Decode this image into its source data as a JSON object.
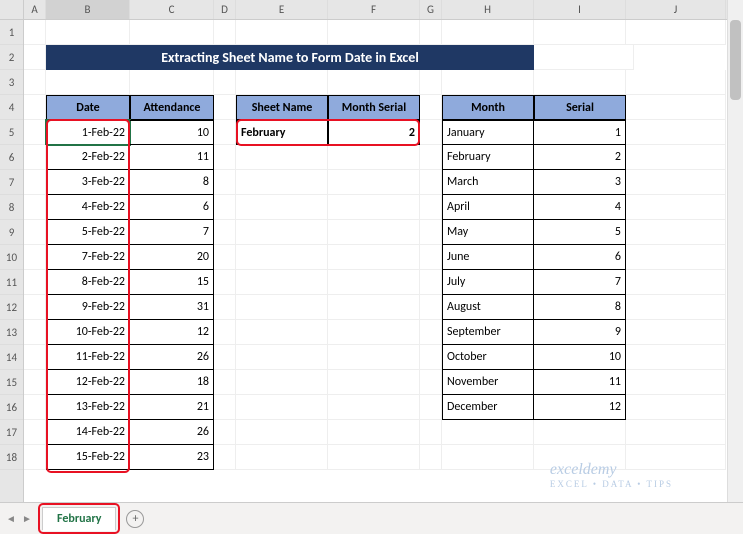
{
  "title": "Extracting Sheet Name to Form Date in Excel",
  "columns": [
    "A",
    "B",
    "C",
    "D",
    "E",
    "F",
    "G",
    "H",
    "I",
    "J"
  ],
  "rowsVisible": 18,
  "headers": {
    "date": "Date",
    "attendance": "Attendance",
    "sheetName": "Sheet Name",
    "monthSerial": "Month Serial",
    "month": "Month",
    "serial": "Serial"
  },
  "lookup": {
    "sheetNameValue": "February",
    "monthSerialValue": 2
  },
  "dateTable": [
    {
      "date": "1-Feb-22",
      "att": 10
    },
    {
      "date": "2-Feb-22",
      "att": 11
    },
    {
      "date": "3-Feb-22",
      "att": 8
    },
    {
      "date": "4-Feb-22",
      "att": 6
    },
    {
      "date": "5-Feb-22",
      "att": 7
    },
    {
      "date": "7-Feb-22",
      "att": 20
    },
    {
      "date": "8-Feb-22",
      "att": 15
    },
    {
      "date": "9-Feb-22",
      "att": 31
    },
    {
      "date": "10-Feb-22",
      "att": 12
    },
    {
      "date": "11-Feb-22",
      "att": 26
    },
    {
      "date": "12-Feb-22",
      "att": 18
    },
    {
      "date": "13-Feb-22",
      "att": 21
    },
    {
      "date": "14-Feb-22",
      "att": 26
    },
    {
      "date": "15-Feb-22",
      "att": 23
    }
  ],
  "monthTable": [
    {
      "m": "January",
      "s": 1
    },
    {
      "m": "February",
      "s": 2
    },
    {
      "m": "March",
      "s": 3
    },
    {
      "m": "April",
      "s": 4
    },
    {
      "m": "May",
      "s": 5
    },
    {
      "m": "June",
      "s": 6
    },
    {
      "m": "July",
      "s": 7
    },
    {
      "m": "August",
      "s": 8
    },
    {
      "m": "September",
      "s": 9
    },
    {
      "m": "October",
      "s": 10
    },
    {
      "m": "November",
      "s": 11
    },
    {
      "m": "December",
      "s": 12
    }
  ],
  "activeTab": "February",
  "watermark": {
    "brand": "exceldemy",
    "tagline": "EXCEL • DATA • TIPS"
  },
  "icons": {
    "addTab": "+",
    "navLeft": "◄",
    "navRight": "►"
  }
}
